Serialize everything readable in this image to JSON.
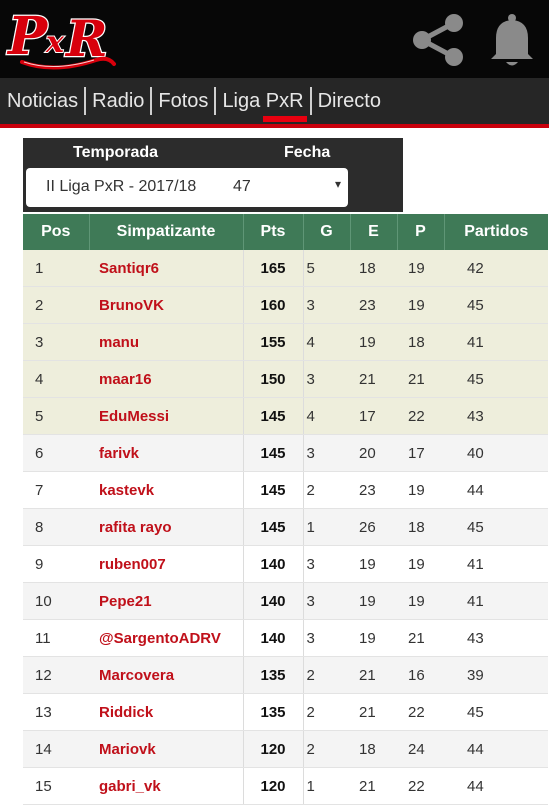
{
  "header": {
    "logo_text": "PxR",
    "brand_red": "#e8000f",
    "share_icon": "share-icon",
    "bell_icon": "bell-icon"
  },
  "nav": {
    "items": [
      {
        "label": "Noticias"
      },
      {
        "label": "Radio"
      },
      {
        "label": "Fotos"
      },
      {
        "label": "Liga PxR"
      },
      {
        "label": "Directo"
      }
    ],
    "active": "Liga PxR"
  },
  "filters": {
    "season_label": "Temporada",
    "date_label": "Fecha",
    "season_value": "II Liga PxR - 2017/18",
    "date_value": "47",
    "caret": "▾"
  },
  "table": {
    "headers": [
      "Pos",
      "Simpatizante",
      "Pts",
      "G",
      "E",
      "P",
      "Partidos"
    ],
    "header_color": "#3f7a57",
    "name_color": "#c0101a",
    "rows": [
      {
        "pos": "1",
        "name": "Santiqr6",
        "pts": "165",
        "g": "5",
        "e": "18",
        "p": "19",
        "m": "42"
      },
      {
        "pos": "2",
        "name": "BrunoVK",
        "pts": "160",
        "g": "3",
        "e": "23",
        "p": "19",
        "m": "45"
      },
      {
        "pos": "3",
        "name": "manu",
        "pts": "155",
        "g": "4",
        "e": "19",
        "p": "18",
        "m": "41"
      },
      {
        "pos": "4",
        "name": "maar16",
        "pts": "150",
        "g": "3",
        "e": "21",
        "p": "21",
        "m": "45"
      },
      {
        "pos": "5",
        "name": "EduMessi",
        "pts": "145",
        "g": "4",
        "e": "17",
        "p": "22",
        "m": "43"
      },
      {
        "pos": "6",
        "name": "farivk",
        "pts": "145",
        "g": "3",
        "e": "20",
        "p": "17",
        "m": "40"
      },
      {
        "pos": "7",
        "name": "kastevk",
        "pts": "145",
        "g": "2",
        "e": "23",
        "p": "19",
        "m": "44"
      },
      {
        "pos": "8",
        "name": "rafita rayo",
        "pts": "145",
        "g": "1",
        "e": "26",
        "p": "18",
        "m": "45"
      },
      {
        "pos": "9",
        "name": "ruben007",
        "pts": "140",
        "g": "3",
        "e": "19",
        "p": "19",
        "m": "41"
      },
      {
        "pos": "10",
        "name": "Pepe21",
        "pts": "140",
        "g": "3",
        "e": "19",
        "p": "19",
        "m": "41"
      },
      {
        "pos": "11",
        "name": "@SargentoADRV",
        "pts": "140",
        "g": "3",
        "e": "19",
        "p": "21",
        "m": "43"
      },
      {
        "pos": "12",
        "name": "Marcovera",
        "pts": "135",
        "g": "2",
        "e": "21",
        "p": "16",
        "m": "39"
      },
      {
        "pos": "13",
        "name": "Riddick",
        "pts": "135",
        "g": "2",
        "e": "21",
        "p": "22",
        "m": "45"
      },
      {
        "pos": "14",
        "name": "Mariovk",
        "pts": "120",
        "g": "2",
        "e": "18",
        "p": "24",
        "m": "44"
      },
      {
        "pos": "15",
        "name": "gabri_vk",
        "pts": "120",
        "g": "1",
        "e": "21",
        "p": "22",
        "m": "44"
      }
    ]
  }
}
